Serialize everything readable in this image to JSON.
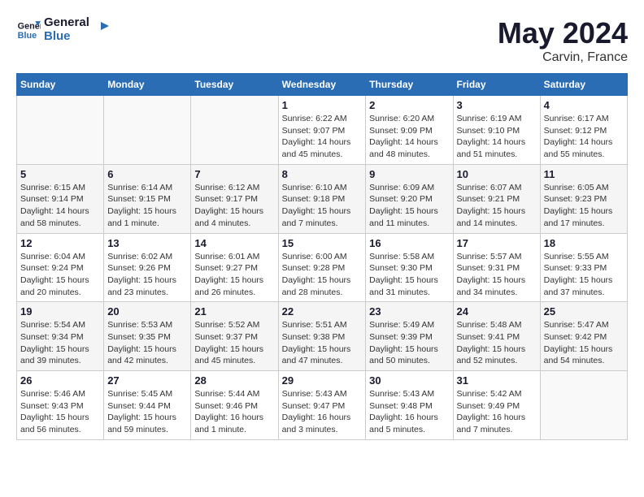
{
  "logo": {
    "line1": "General",
    "line2": "Blue"
  },
  "title": "May 2024",
  "location": "Carvin, France",
  "headers": [
    "Sunday",
    "Monday",
    "Tuesday",
    "Wednesday",
    "Thursday",
    "Friday",
    "Saturday"
  ],
  "weeks": [
    [
      {
        "day": "",
        "info": ""
      },
      {
        "day": "",
        "info": ""
      },
      {
        "day": "",
        "info": ""
      },
      {
        "day": "1",
        "info": "Sunrise: 6:22 AM\nSunset: 9:07 PM\nDaylight: 14 hours\nand 45 minutes."
      },
      {
        "day": "2",
        "info": "Sunrise: 6:20 AM\nSunset: 9:09 PM\nDaylight: 14 hours\nand 48 minutes."
      },
      {
        "day": "3",
        "info": "Sunrise: 6:19 AM\nSunset: 9:10 PM\nDaylight: 14 hours\nand 51 minutes."
      },
      {
        "day": "4",
        "info": "Sunrise: 6:17 AM\nSunset: 9:12 PM\nDaylight: 14 hours\nand 55 minutes."
      }
    ],
    [
      {
        "day": "5",
        "info": "Sunrise: 6:15 AM\nSunset: 9:14 PM\nDaylight: 14 hours\nand 58 minutes."
      },
      {
        "day": "6",
        "info": "Sunrise: 6:14 AM\nSunset: 9:15 PM\nDaylight: 15 hours\nand 1 minute."
      },
      {
        "day": "7",
        "info": "Sunrise: 6:12 AM\nSunset: 9:17 PM\nDaylight: 15 hours\nand 4 minutes."
      },
      {
        "day": "8",
        "info": "Sunrise: 6:10 AM\nSunset: 9:18 PM\nDaylight: 15 hours\nand 7 minutes."
      },
      {
        "day": "9",
        "info": "Sunrise: 6:09 AM\nSunset: 9:20 PM\nDaylight: 15 hours\nand 11 minutes."
      },
      {
        "day": "10",
        "info": "Sunrise: 6:07 AM\nSunset: 9:21 PM\nDaylight: 15 hours\nand 14 minutes."
      },
      {
        "day": "11",
        "info": "Sunrise: 6:05 AM\nSunset: 9:23 PM\nDaylight: 15 hours\nand 17 minutes."
      }
    ],
    [
      {
        "day": "12",
        "info": "Sunrise: 6:04 AM\nSunset: 9:24 PM\nDaylight: 15 hours\nand 20 minutes."
      },
      {
        "day": "13",
        "info": "Sunrise: 6:02 AM\nSunset: 9:26 PM\nDaylight: 15 hours\nand 23 minutes."
      },
      {
        "day": "14",
        "info": "Sunrise: 6:01 AM\nSunset: 9:27 PM\nDaylight: 15 hours\nand 26 minutes."
      },
      {
        "day": "15",
        "info": "Sunrise: 6:00 AM\nSunset: 9:28 PM\nDaylight: 15 hours\nand 28 minutes."
      },
      {
        "day": "16",
        "info": "Sunrise: 5:58 AM\nSunset: 9:30 PM\nDaylight: 15 hours\nand 31 minutes."
      },
      {
        "day": "17",
        "info": "Sunrise: 5:57 AM\nSunset: 9:31 PM\nDaylight: 15 hours\nand 34 minutes."
      },
      {
        "day": "18",
        "info": "Sunrise: 5:55 AM\nSunset: 9:33 PM\nDaylight: 15 hours\nand 37 minutes."
      }
    ],
    [
      {
        "day": "19",
        "info": "Sunrise: 5:54 AM\nSunset: 9:34 PM\nDaylight: 15 hours\nand 39 minutes."
      },
      {
        "day": "20",
        "info": "Sunrise: 5:53 AM\nSunset: 9:35 PM\nDaylight: 15 hours\nand 42 minutes."
      },
      {
        "day": "21",
        "info": "Sunrise: 5:52 AM\nSunset: 9:37 PM\nDaylight: 15 hours\nand 45 minutes."
      },
      {
        "day": "22",
        "info": "Sunrise: 5:51 AM\nSunset: 9:38 PM\nDaylight: 15 hours\nand 47 minutes."
      },
      {
        "day": "23",
        "info": "Sunrise: 5:49 AM\nSunset: 9:39 PM\nDaylight: 15 hours\nand 50 minutes."
      },
      {
        "day": "24",
        "info": "Sunrise: 5:48 AM\nSunset: 9:41 PM\nDaylight: 15 hours\nand 52 minutes."
      },
      {
        "day": "25",
        "info": "Sunrise: 5:47 AM\nSunset: 9:42 PM\nDaylight: 15 hours\nand 54 minutes."
      }
    ],
    [
      {
        "day": "26",
        "info": "Sunrise: 5:46 AM\nSunset: 9:43 PM\nDaylight: 15 hours\nand 56 minutes."
      },
      {
        "day": "27",
        "info": "Sunrise: 5:45 AM\nSunset: 9:44 PM\nDaylight: 15 hours\nand 59 minutes."
      },
      {
        "day": "28",
        "info": "Sunrise: 5:44 AM\nSunset: 9:46 PM\nDaylight: 16 hours\nand 1 minute."
      },
      {
        "day": "29",
        "info": "Sunrise: 5:43 AM\nSunset: 9:47 PM\nDaylight: 16 hours\nand 3 minutes."
      },
      {
        "day": "30",
        "info": "Sunrise: 5:43 AM\nSunset: 9:48 PM\nDaylight: 16 hours\nand 5 minutes."
      },
      {
        "day": "31",
        "info": "Sunrise: 5:42 AM\nSunset: 9:49 PM\nDaylight: 16 hours\nand 7 minutes."
      },
      {
        "day": "",
        "info": ""
      }
    ]
  ]
}
